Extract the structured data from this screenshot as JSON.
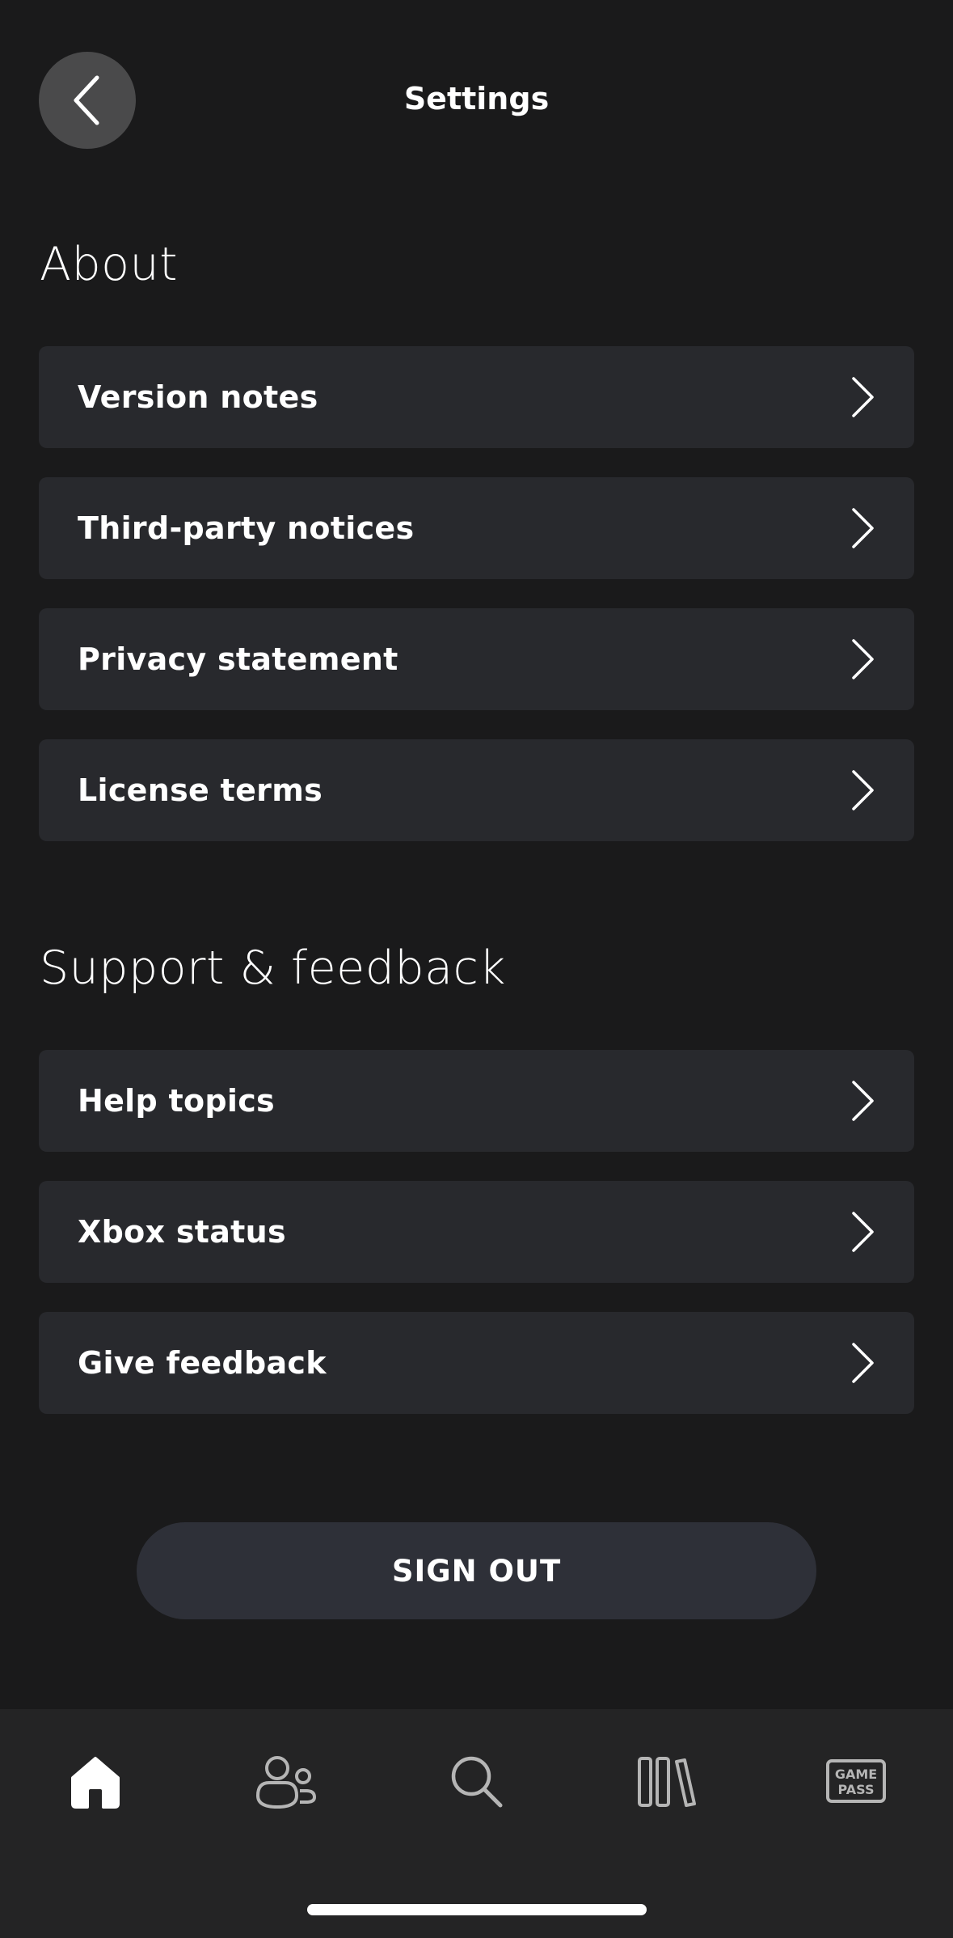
{
  "header": {
    "title": "Settings"
  },
  "about": {
    "heading": "About",
    "items": [
      {
        "label": "Version notes"
      },
      {
        "label": "Third-party notices"
      },
      {
        "label": "Privacy statement"
      },
      {
        "label": "License terms"
      }
    ]
  },
  "support": {
    "heading": "Support & feedback",
    "items": [
      {
        "label": "Help topics"
      },
      {
        "label": "Xbox status"
      },
      {
        "label": "Give feedback"
      }
    ]
  },
  "sign_out": {
    "label": "SIGN OUT"
  },
  "tabbar": {
    "tabs": [
      {
        "icon": "home-icon",
        "active": true
      },
      {
        "icon": "social-icon",
        "active": false
      },
      {
        "icon": "search-icon",
        "active": false
      },
      {
        "icon": "library-icon",
        "active": false
      },
      {
        "icon": "game-pass-icon",
        "active": false,
        "badge_line1": "GAME",
        "badge_line2": "PASS"
      }
    ]
  },
  "colors": {
    "background": "#1a1a1b",
    "row": "#28292d",
    "button": "#2e3038",
    "tabbar": "#242425"
  }
}
